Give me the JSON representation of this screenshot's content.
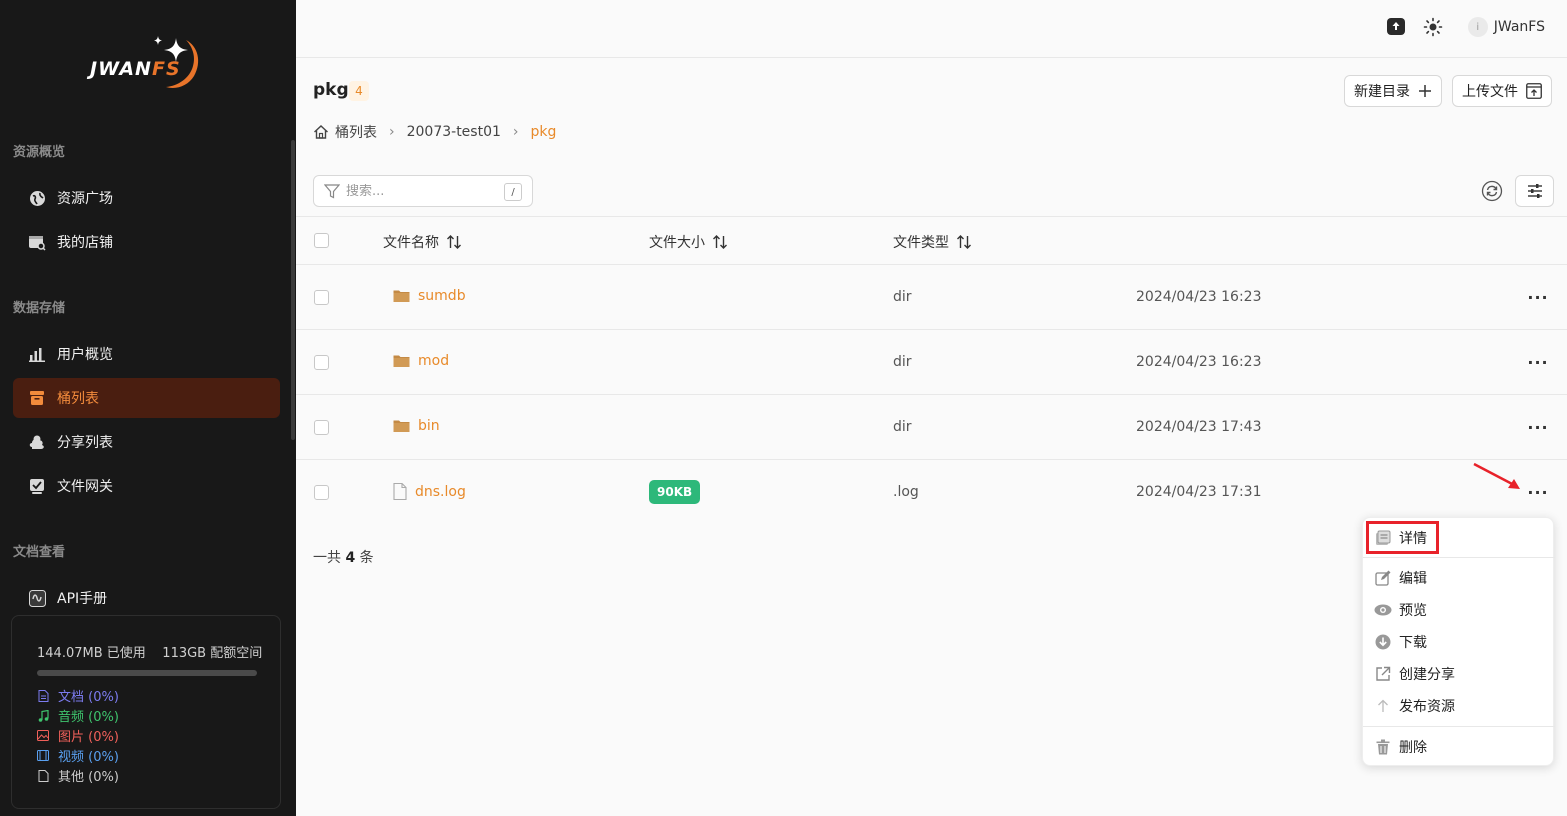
{
  "sidebar": {
    "logo_text": "JWAN",
    "logo_text_accent": "FS",
    "sections": [
      {
        "title": "资源概览",
        "items": [
          {
            "label": "资源广场",
            "icon": "globe-icon"
          },
          {
            "label": "我的店铺",
            "icon": "store-icon"
          }
        ]
      },
      {
        "title": "数据存储",
        "items": [
          {
            "label": "用户概览",
            "icon": "bar-chart-icon"
          },
          {
            "label": "桶列表",
            "icon": "bucket-icon",
            "active": true
          },
          {
            "label": "分享列表",
            "icon": "cloud-share-icon"
          },
          {
            "label": "文件网关",
            "icon": "gateway-icon"
          }
        ]
      },
      {
        "title": "文档查看",
        "items": [
          {
            "label": "API手册",
            "icon": "api-icon"
          }
        ]
      }
    ],
    "storage": {
      "used": "144.07MB 已使用",
      "quota": "113GB 配额空间",
      "used_fraction": 0.001,
      "legend": [
        {
          "label": "文档 (0%)",
          "color": "#7c7cf0",
          "icon": "document-icon"
        },
        {
          "label": "音频 (0%)",
          "color": "#3ec46d",
          "icon": "music-icon"
        },
        {
          "label": "图片 (0%)",
          "color": "#f0605a",
          "icon": "image-icon"
        },
        {
          "label": "视频 (0%)",
          "color": "#5aa0f0",
          "icon": "video-icon"
        },
        {
          "label": "其他 (0%)",
          "color": "#cccccc",
          "icon": "file-icon"
        }
      ]
    }
  },
  "topbar": {
    "avatar_initial": "i",
    "username": "JWanFS"
  },
  "main": {
    "title": "pkg",
    "count": "4",
    "new_dir_label": "新建目录",
    "upload_label": "上传文件",
    "breadcrumb": [
      "桶列表",
      "20073-test01",
      "pkg"
    ],
    "search_placeholder": "搜索...",
    "search_shortcut": "/",
    "columns": [
      "文件名称",
      "文件大小",
      "文件类型"
    ],
    "rows": [
      {
        "name": "sumdb",
        "size": "",
        "type": "dir",
        "date": "2024/04/23 16:23",
        "kind": "folder"
      },
      {
        "name": "mod",
        "size": "",
        "type": "dir",
        "date": "2024/04/23 16:23",
        "kind": "folder"
      },
      {
        "name": "bin",
        "size": "",
        "type": "dir",
        "date": "2024/04/23 17:43",
        "kind": "folder"
      },
      {
        "name": "dns.log",
        "size": "90KB",
        "type": ".log",
        "date": "2024/04/23 17:31",
        "kind": "file"
      }
    ],
    "total_prefix": "一共",
    "total_count": "4",
    "total_suffix": "条",
    "more_label": "···"
  },
  "context_menu": {
    "items": [
      "详情",
      "编辑",
      "预览",
      "下载",
      "创建分享",
      "发布资源",
      "删除"
    ]
  },
  "colors": {
    "accent": "#e88a2a",
    "sidebar_bg": "#181818",
    "active_bg": "#4a1e10",
    "size_badge": "#2db87a",
    "highlight": "#e8222a"
  }
}
